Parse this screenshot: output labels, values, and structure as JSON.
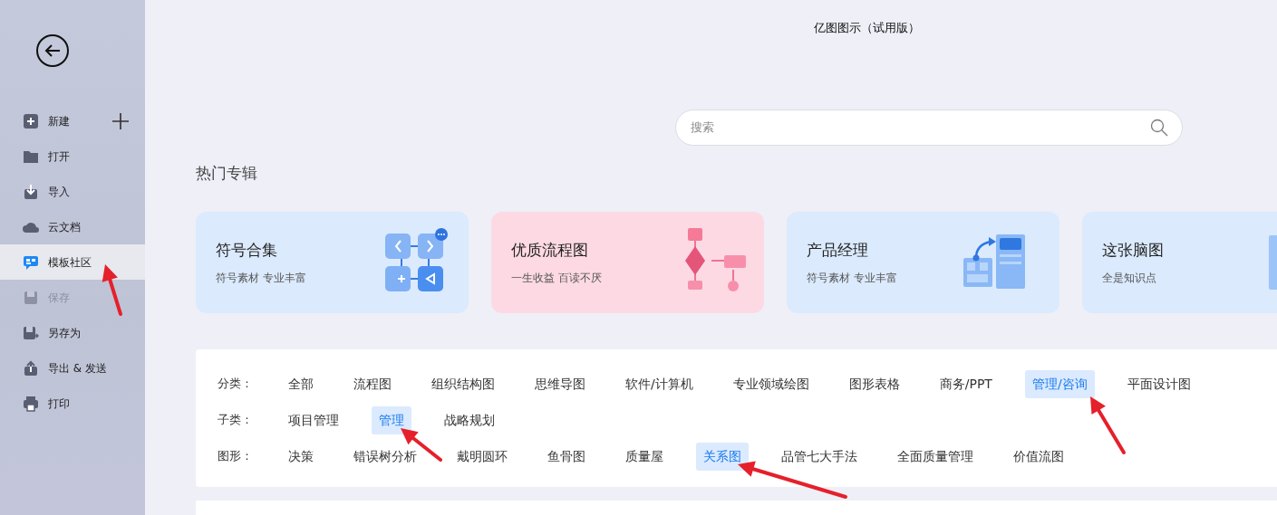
{
  "window": {
    "title": "亿图图示（试用版）"
  },
  "sidebar": {
    "items": [
      {
        "label": "新建",
        "kind": "new",
        "selected": false,
        "disabled": false
      },
      {
        "label": "打开",
        "kind": "open",
        "selected": false,
        "disabled": false
      },
      {
        "label": "导入",
        "kind": "import",
        "selected": false,
        "disabled": false
      },
      {
        "label": "云文档",
        "kind": "cloud",
        "selected": false,
        "disabled": false
      },
      {
        "label": "模板社区",
        "kind": "community",
        "selected": true,
        "disabled": false
      },
      {
        "label": "保存",
        "kind": "save",
        "selected": false,
        "disabled": true
      },
      {
        "label": "另存为",
        "kind": "saveas",
        "selected": false,
        "disabled": false
      },
      {
        "label": "导出 & 发送",
        "kind": "export",
        "selected": false,
        "disabled": false
      },
      {
        "label": "打印",
        "kind": "print",
        "selected": false,
        "disabled": false
      }
    ]
  },
  "search": {
    "placeholder": "搜索"
  },
  "featured": {
    "heading": "热门专辑",
    "cards": [
      {
        "title": "符号合集",
        "subtitle": "符号素材 专业丰富",
        "kind": "symbols",
        "color": "#dbeafd"
      },
      {
        "title": "优质流程图",
        "subtitle": "一生收益 百读不厌",
        "kind": "flowchart",
        "color": "#fdd9e3"
      },
      {
        "title": "产品经理",
        "subtitle": "符号素材 专业丰富",
        "kind": "product",
        "color": "#dbeafd"
      },
      {
        "title": "这张脑图",
        "subtitle": "全是知识点",
        "kind": "mindmap",
        "color": "#dbeafd"
      }
    ]
  },
  "filters": [
    {
      "label": "分类：",
      "options": [
        {
          "label": "全部",
          "selected": false
        },
        {
          "label": "流程图",
          "selected": false
        },
        {
          "label": "组织结构图",
          "selected": false
        },
        {
          "label": "思维导图",
          "selected": false
        },
        {
          "label": "软件/计算机",
          "selected": false
        },
        {
          "label": "专业领域绘图",
          "selected": false
        },
        {
          "label": "图形表格",
          "selected": false
        },
        {
          "label": "商务/PPT",
          "selected": false
        },
        {
          "label": "管理/咨询",
          "selected": true
        },
        {
          "label": "平面设计图",
          "selected": false
        }
      ]
    },
    {
      "label": "子类：",
      "options": [
        {
          "label": "项目管理",
          "selected": false
        },
        {
          "label": "管理",
          "selected": true
        },
        {
          "label": "战略规划",
          "selected": false
        }
      ]
    },
    {
      "label": "图形：",
      "options": [
        {
          "label": "决策",
          "selected": false
        },
        {
          "label": "错误树分析",
          "selected": false
        },
        {
          "label": "戴明圆环",
          "selected": false
        },
        {
          "label": "鱼骨图",
          "selected": false
        },
        {
          "label": "质量屋",
          "selected": false
        },
        {
          "label": "关系图",
          "selected": true
        },
        {
          "label": "品管七大手法",
          "selected": false
        },
        {
          "label": "全面质量管理",
          "selected": false
        },
        {
          "label": "价值流图",
          "selected": false
        }
      ]
    }
  ]
}
